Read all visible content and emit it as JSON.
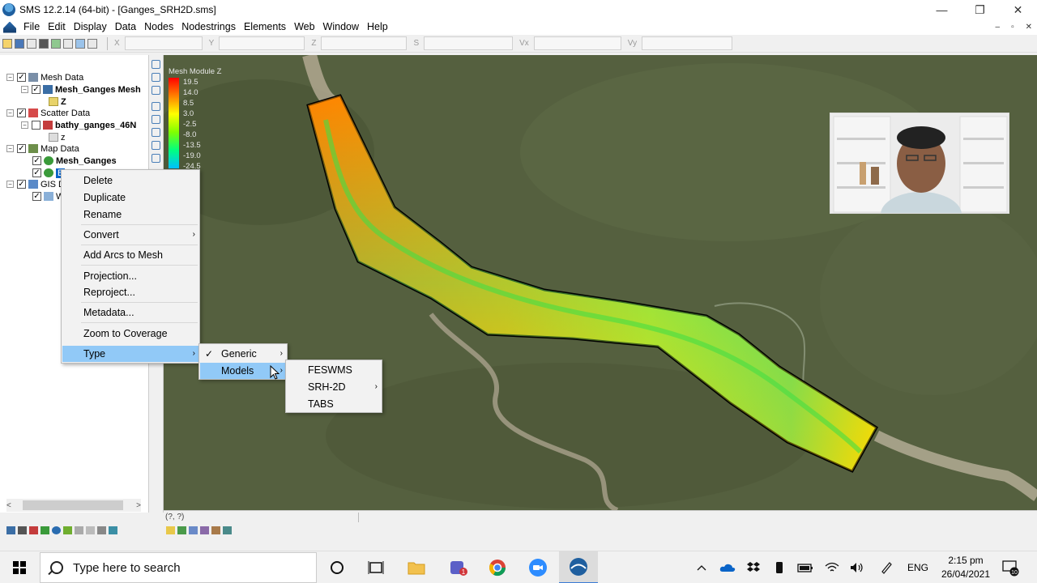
{
  "window": {
    "title": "SMS 12.2.14 (64-bit) - [Ganges_SRH2D.sms]",
    "minimize": "—",
    "maximize": "❐",
    "close": "✕"
  },
  "menu": {
    "items": [
      "File",
      "Edit",
      "Display",
      "Data",
      "Nodes",
      "Nodestrings",
      "Elements",
      "Web",
      "Window",
      "Help"
    ],
    "mdi_minimize": "–",
    "mdi_restore": "▫",
    "mdi_close": "✕"
  },
  "toolbar": {
    "coord_labels": [
      "X",
      "Y",
      "Z",
      "S",
      "Vx",
      "Vy"
    ]
  },
  "tree": {
    "mesh_data": "Mesh Data",
    "mesh_ganges": "Mesh_Ganges Mesh",
    "z_dataset": "Z",
    "scatter_data": "Scatter Data",
    "bathy": "bathy_ganges_46N",
    "bathy_z": "z",
    "map_data": "Map Data",
    "map_ganges": "Mesh_Ganges",
    "selected_cov": "B",
    "gis_data": "GIS D",
    "gis_child": "W"
  },
  "legend": {
    "title": "Mesh Module Z",
    "labels": [
      "19.5",
      "14.0",
      "8.5",
      "3.0",
      "-2.5",
      "-8.0",
      "-13.5",
      "-19.0",
      "-24.5"
    ]
  },
  "status": {
    "coords": "(?, ?)"
  },
  "context_menu": {
    "items": [
      "Delete",
      "Duplicate",
      "Rename",
      "Convert",
      "Add Arcs to Mesh",
      "Projection...",
      "Reproject...",
      "Metadata...",
      "Zoom to Coverage",
      "Type"
    ],
    "arrow": "›"
  },
  "type_submenu": {
    "items": [
      "Generic",
      "Models"
    ],
    "check": "✓"
  },
  "models_submenu": {
    "items": [
      "FESWMS",
      "SRH-2D",
      "TABS"
    ]
  },
  "taskbar": {
    "search_placeholder": "Type here to search",
    "notification_count": "1",
    "language": "ENG",
    "time": "2:15 pm",
    "date": "26/04/2021",
    "action_center_count": "10"
  },
  "colors": {
    "menu_highlight": "#91c9f7",
    "mesh_high": "#ff6a00",
    "mesh_mid": "#ffe600",
    "mesh_low": "#33dd33",
    "boundary": "#000000"
  }
}
